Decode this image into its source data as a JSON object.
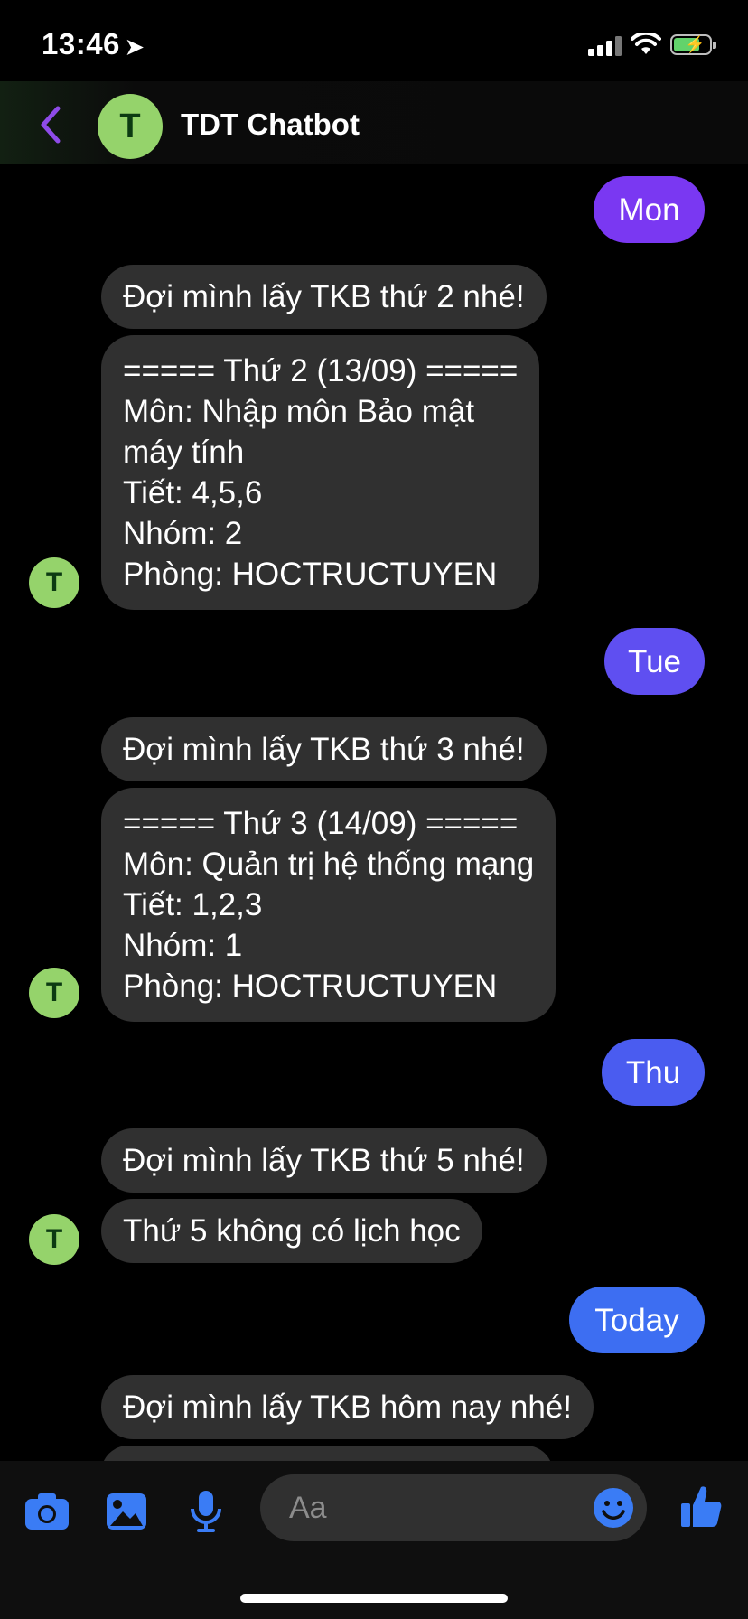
{
  "status": {
    "time": "13:46",
    "location_icon": "location-arrow-icon"
  },
  "header": {
    "title": "TDT Chatbot",
    "avatar_letter": "T"
  },
  "messages": {
    "m1": {
      "text": "Mon",
      "color": "#7a38f2"
    },
    "m2": {
      "text": "Đợi mình lấy TKB thứ 2 nhé!"
    },
    "m3": {
      "text": "===== Thứ 2 (13/09) =====\nMôn: Nhập môn Bảo mật\nmáy tính\nTiết: 4,5,6\nNhóm: 2\nPhòng: HOCTRUCTUYEN"
    },
    "m4": {
      "text": "Tue",
      "color": "#5f4ff1"
    },
    "m5": {
      "text": "Đợi mình lấy TKB thứ 3 nhé!"
    },
    "m6": {
      "text": "===== Thứ 3 (14/09) =====\nMôn: Quản trị hệ thống mạng\nTiết: 1,2,3\nNhóm: 1\nPhòng: HOCTRUCTUYEN"
    },
    "m7": {
      "text": "Thu",
      "color": "#4a5cf0"
    },
    "m8": {
      "text": "Đợi mình lấy TKB thứ 5 nhé!"
    },
    "m9": {
      "text": "Thứ 5 không có lịch học"
    },
    "m10": {
      "text": "Today",
      "color": "#3d6ef2"
    },
    "m11": {
      "text": "Đợi mình lấy TKB hôm nay nhé!"
    }
  },
  "composer": {
    "placeholder": "Aa"
  },
  "colors": {
    "accent": "#3a7cf5",
    "avatar": "#95d36b",
    "bot_bubble": "#303030",
    "back": "#8e4be8"
  }
}
